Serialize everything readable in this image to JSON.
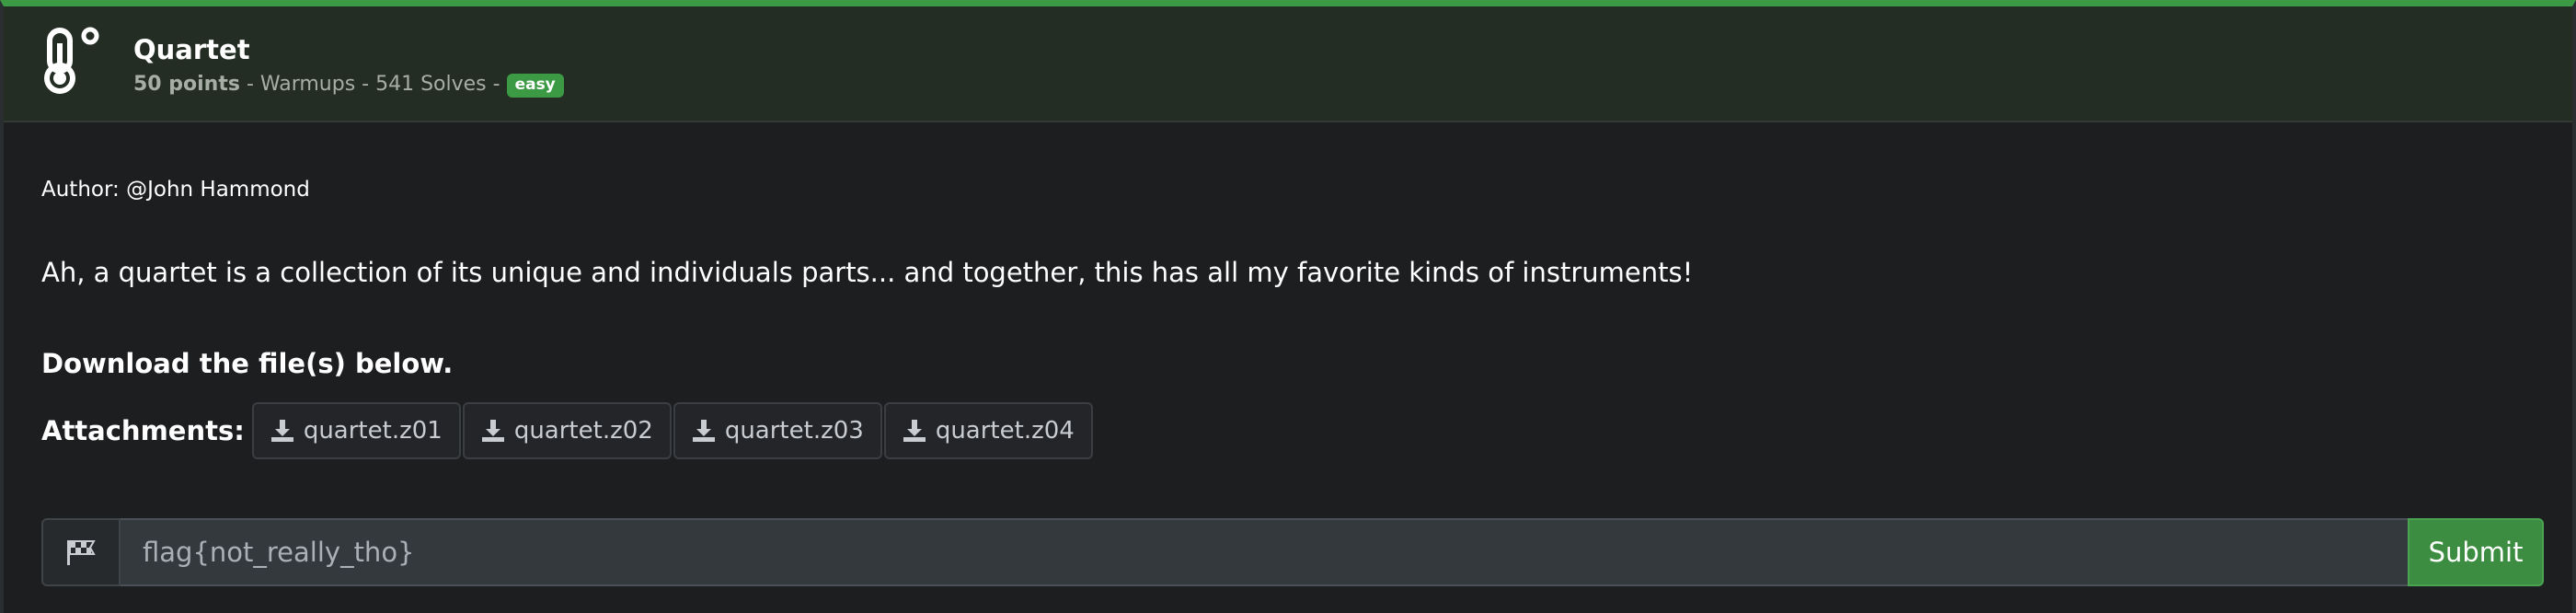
{
  "challenge": {
    "title": "Quartet",
    "points": "50 points",
    "category_and_solves": " - Warmups - 541 Solves - ",
    "difficulty": "easy",
    "icon": "thermometer-icon"
  },
  "body": {
    "author": "Author: @John Hammond",
    "description": "Ah, a quartet is a collection of its unique and individuals parts... and together, this has all my favorite kinds of instruments!",
    "download_note": "Download the file(s) below.",
    "attachments_label": "Attachments:",
    "attachments": [
      {
        "name": "quartet.z01",
        "icon": "download-icon"
      },
      {
        "name": "quartet.z02",
        "icon": "download-icon"
      },
      {
        "name": "quartet.z03",
        "icon": "download-icon"
      },
      {
        "name": "quartet.z04",
        "icon": "download-icon"
      }
    ]
  },
  "flag_form": {
    "prefix_icon": "checkered-flag-icon",
    "placeholder": "flag{not_really_tho}",
    "submit_label": "Submit"
  },
  "colors": {
    "accent": "#3c9a44",
    "header_bg": "#232d23",
    "body_bg": "#1c1e20"
  }
}
